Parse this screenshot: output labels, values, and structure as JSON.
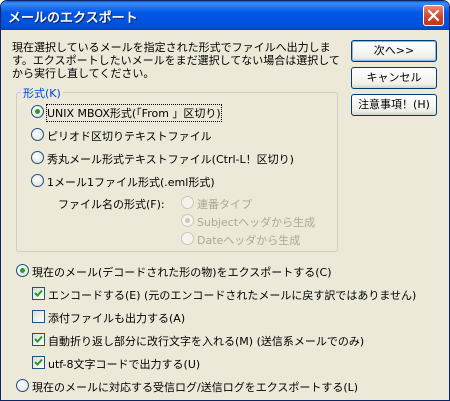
{
  "window": {
    "title": "メールのエクスポート"
  },
  "description": {
    "line1": "現在選択しているメールを指定された形式でファイルへ出力しま",
    "line2": "す。エクスポートしたいメールをまだ選択してない場合は選択して",
    "line3": "から実行し直してください。"
  },
  "buttons": {
    "next": "次へ>>",
    "cancel": "キャンセル",
    "notes": "注意事項！(H)"
  },
  "format_group": {
    "label": "形式(K)",
    "options": [
      {
        "label": "UNIX MBOX形式(「From 」区切り)",
        "checked": true
      },
      {
        "label": "ピリオド区切りテキストファイル",
        "checked": false
      },
      {
        "label": "秀丸メール形式テキストファイル(Ctrl-L！区切り)",
        "checked": false
      },
      {
        "label": "1メール1ファイル形式(.eml形式)",
        "checked": false
      }
    ],
    "filename_label": "ファイル名の形式(F):",
    "filename_options": [
      {
        "label": "連番タイプ",
        "checked": false
      },
      {
        "label": "Subjectヘッダから生成",
        "checked": true
      },
      {
        "label": "Dateヘッダから生成",
        "checked": false
      }
    ]
  },
  "export_current": {
    "label": "現在のメール(デコードされた形の物)をエクスポートする(C)",
    "checked": true,
    "checkboxes": [
      {
        "label": "エンコードする(E)  (元のエンコードされたメールに戻す訳ではありません)",
        "checked": true
      },
      {
        "label": "添付ファイルも出力する(A)",
        "checked": false
      },
      {
        "label": "自動折り返し部分に改行文字を入れる(M)  (送信系メールでのみ)",
        "checked": true
      },
      {
        "label": "utf-8文字コードで出力する(U)",
        "checked": true
      }
    ]
  },
  "export_log": {
    "label": "現在のメールに対応する受信ログ/送信ログをエクスポートする(L)",
    "checked": false
  }
}
